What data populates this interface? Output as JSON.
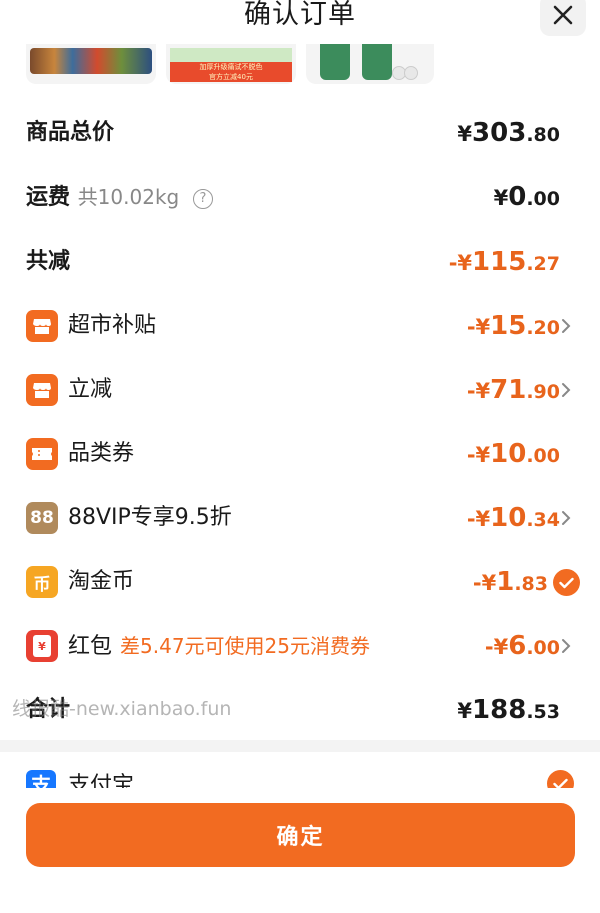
{
  "header": {
    "title": "确认订单"
  },
  "thumbs": {
    "promo_line1": "加厚升级痛试不脱色",
    "promo_line2": "官方立减40元"
  },
  "summary": {
    "goods_total": {
      "label": "商品总价",
      "yen": "¥",
      "int": "303",
      "cents": ".80"
    },
    "shipping": {
      "label": "运费",
      "weight": "共10.02kg",
      "help": "?",
      "yen": "¥",
      "int": "0",
      "cents": ".00"
    },
    "total_reduce": {
      "label": "共减",
      "yen": "-¥",
      "int": "115",
      "cents": ".27"
    }
  },
  "discounts": [
    {
      "label": "超市补贴",
      "yen": "-¥",
      "int": "15",
      "cents": ".20",
      "icon": "store-icon"
    },
    {
      "label": "立减",
      "yen": "-¥",
      "int": "71",
      "cents": ".90",
      "icon": "store-icon"
    },
    {
      "label": "品类券",
      "yen": "-¥",
      "int": "10",
      "cents": ".00",
      "icon": "ticket-icon"
    },
    {
      "label": "88VIP专享9.5折",
      "yen": "-¥",
      "int": "10",
      "cents": ".34",
      "icon": "vip88-icon",
      "icon_text": "88"
    },
    {
      "label": "淘金币",
      "yen": "-¥",
      "int": "1",
      "cents": ".83",
      "icon": "coin-icon",
      "icon_text": "币"
    },
    {
      "label": "红包",
      "hint": "差5.47元可使用25元消费券",
      "yen": "-¥",
      "int": "6",
      "cents": ".00",
      "icon": "red-packet-icon",
      "icon_text": "¥"
    }
  ],
  "total": {
    "label": "合计",
    "yen": "¥",
    "int": "188",
    "cents": ".53"
  },
  "watermark": "线报酷-new.xianbao.fun",
  "payment": {
    "label": "支付宝",
    "icon_text": "支"
  },
  "confirm_label": "确定",
  "colors": {
    "accent": "#f26b21",
    "gold": "#b08a5c",
    "coin": "#f6a623",
    "red": "#e84032"
  }
}
